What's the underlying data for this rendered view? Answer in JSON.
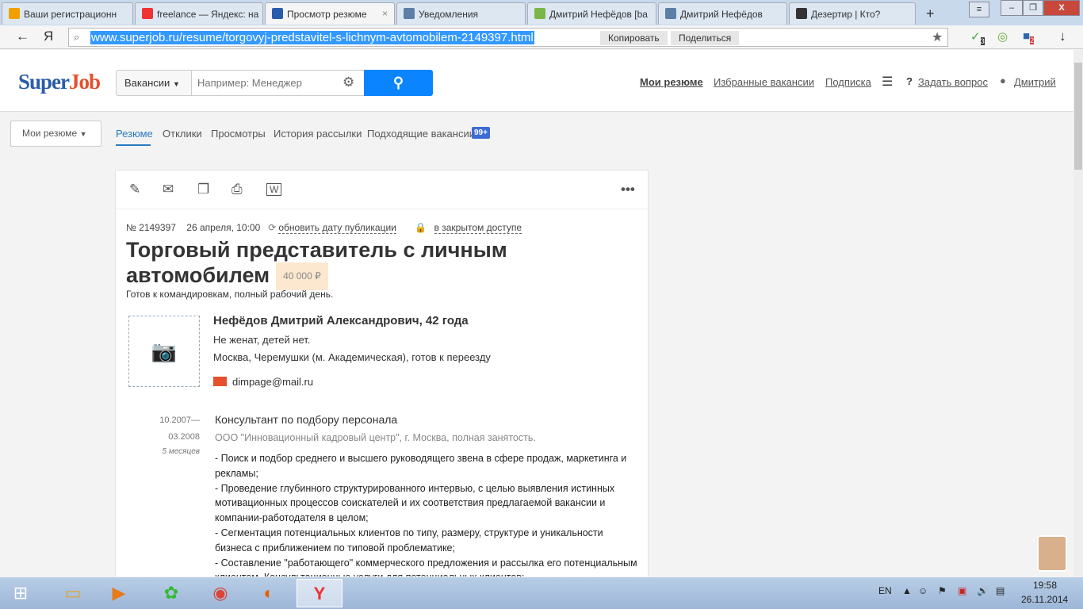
{
  "browser": {
    "tabs": [
      {
        "label": "Ваши регистрационн",
        "icon": "mail-icon",
        "color": "#f0a000"
      },
      {
        "label": "freelance — Яндекс: на",
        "icon": "yandex-icon",
        "color": "#e33"
      },
      {
        "label": "Просмотр резюме",
        "icon": "superjob-icon",
        "color": "#2a5caa",
        "active": true
      },
      {
        "label": "Уведомления",
        "icon": "vk-icon",
        "color": "#5b7fa6"
      },
      {
        "label": "Дмитрий Нефёдов [ba",
        "icon": "fl-icon",
        "color": "#7ab648"
      },
      {
        "label": "Дмитрий Нефёдов",
        "icon": "vk-icon",
        "color": "#5b7fa6"
      },
      {
        "label": "Дезертир | Кто?",
        "icon": "runner-icon",
        "color": "#333"
      }
    ],
    "tab_close": "×",
    "new_tab": "+",
    "url": "www.superjob.ru/resume/torgovyj-predstavitel-s-lichnym-avtomobilem-2149397.html",
    "copy": "Копировать",
    "share": "Поделиться",
    "ext_badges": [
      "3",
      "2"
    ]
  },
  "site": {
    "logo_a": "Super",
    "logo_b": "Job",
    "search_type": "Вакансии",
    "search_placeholder": "Например: Менеджер",
    "nav": [
      "Мои резюме",
      "Избранные вакансии",
      "Подписка",
      "Задать вопрос",
      "Дмитрий"
    ],
    "my_resumes": "Мои резюме",
    "subnav": [
      "Резюме",
      "Отклики",
      "Просмотры",
      "История рассылки",
      "Подходящие вакансии"
    ],
    "badge": "99+"
  },
  "resume": {
    "number": "№ 2149397",
    "date": "26 апреля, 10:00",
    "update": "обновить дату публикации",
    "access": "в закрытом доступе",
    "title": "Торговый представитель с личным автомобилем",
    "salary": "40 000 ₽",
    "conditions": "Готов к командировкам, полный рабочий день.",
    "name": "Нефёдов Дмитрий Александрович, 42 года",
    "family": "Не женат, детей нет.",
    "location": "Москва, Черемушки (м. Академическая), готов к переезду",
    "email": "dimpage@mail.ru",
    "job": {
      "from": "10.2007—",
      "to": "03.2008",
      "duration": "5 месяцев",
      "position": "Консультант по подбору персонала",
      "company": "ООО \"Инновационный кадровый центр\", г. Москва, полная занятость.",
      "description": [
        "- Поиск и подбор среднего и высшего руководящего звена в сфере продаж, маркетинга и рекламы;",
        "- Проведение глубинного структурированного интервью, с целью выявления истинных мотивационных процессов соискателей и их соответствия предлагаемой вакансии и компании-работодателя в целом;",
        "- Сегментация потенциальных клиентов по типу, размеру, структуре и уникальности бизнеса с приближением по типовой проблематике;",
        "- Составление \"работающего\" коммерческого предложения и рассылка его потенциальным клиентам. Консультационные услуги для потенциальных клиентов;"
      ]
    }
  },
  "taskbar": {
    "lang": "EN",
    "time": "19:58",
    "date": "26.11.2014"
  }
}
